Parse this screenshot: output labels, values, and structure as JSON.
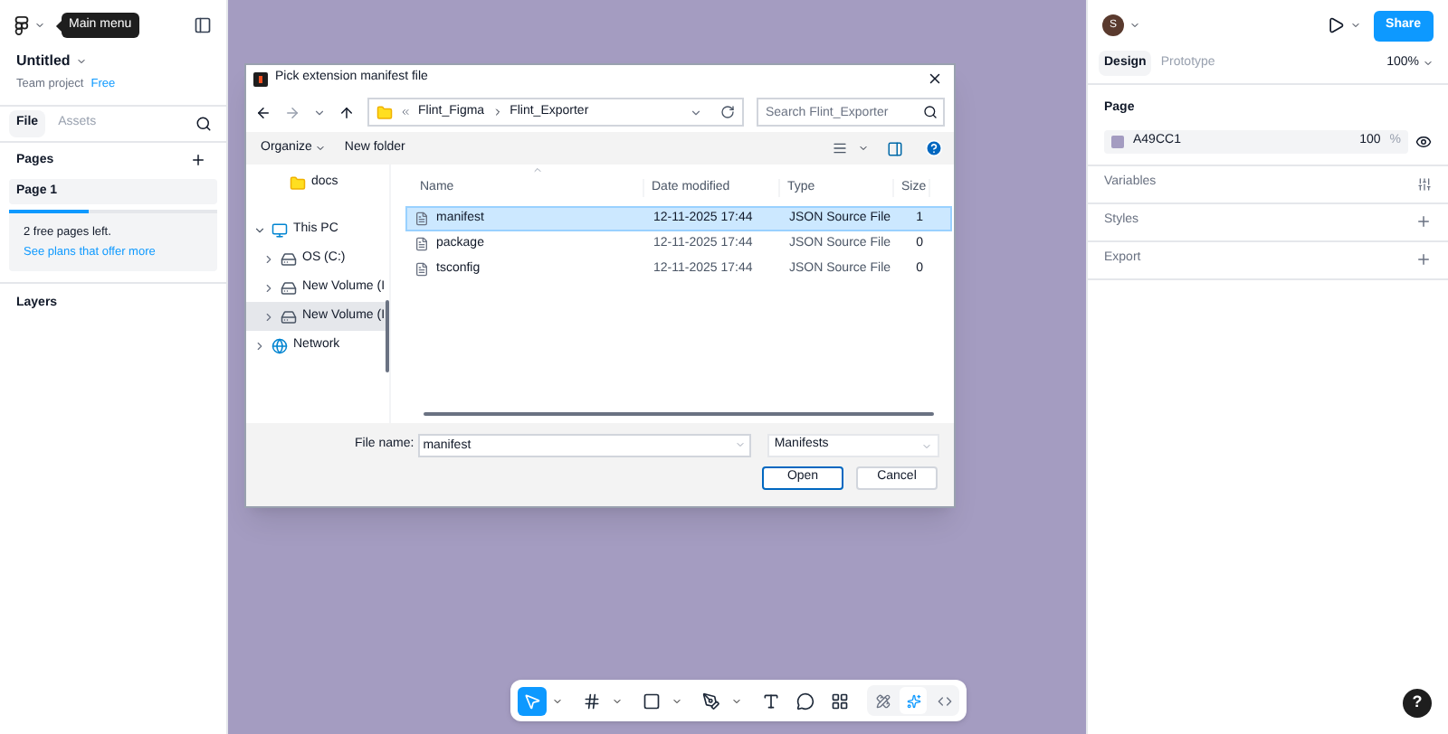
{
  "left_panel": {
    "tooltip": "Main menu",
    "file_name": "Untitled",
    "team": "Team project",
    "plan": "Free",
    "tabs": [
      {
        "label": "File",
        "selected": true
      },
      {
        "label": "Assets",
        "selected": false
      }
    ],
    "pages_title": "Pages",
    "pages": [
      {
        "label": "Page 1",
        "selected": true
      }
    ],
    "upgrade": {
      "level": 0.38,
      "text": "2 free pages left.",
      "link": "See plans that offer more"
    },
    "layers_title": "Layers"
  },
  "dialog": {
    "title": "Pick extension manifest file",
    "path": [
      "Flint_Figma",
      "Flint_Exporter"
    ],
    "search_placeholder": "Search Flint_Exporter",
    "toolbar": [
      "Organize",
      "New folder"
    ],
    "nav": [
      {
        "label": "docs",
        "kind": "folder",
        "selected": false
      },
      {
        "label": "This PC",
        "kind": "pc",
        "expanded": true,
        "selected": false,
        "children": [
          {
            "label": "OS (C:)",
            "kind": "drive",
            "expanded": false,
            "selected": false
          },
          {
            "label": "New Volume (I",
            "kind": "drive",
            "expanded": false,
            "selected": false
          },
          {
            "label": "New Volume (I",
            "kind": "drive",
            "expanded": false,
            "selected": true
          }
        ]
      },
      {
        "label": "Network",
        "kind": "network",
        "expanded": false,
        "selected": false
      }
    ],
    "columns": [
      "Name",
      "Date modified",
      "Type",
      "Size"
    ],
    "rows": [
      {
        "name": "manifest",
        "date": "12-11-2025 17:44",
        "type": "JSON Source File",
        "size": "1",
        "selected": true
      },
      {
        "name": "package",
        "date": "12-11-2025 17:44",
        "type": "JSON Source File",
        "size": "0",
        "selected": false
      },
      {
        "name": "tsconfig",
        "date": "12-11-2025 17:44",
        "type": "JSON Source File",
        "size": "0",
        "selected": false
      }
    ],
    "file_name_label": "File name:",
    "file_name_value": "manifest",
    "filter": "Manifests",
    "buttons": [
      {
        "label": "Open",
        "default": true
      },
      {
        "label": "Cancel",
        "default": false
      }
    ]
  },
  "canvas": {
    "color": "#a49cc1"
  },
  "toolbar": {
    "tools": [
      {
        "kind": "move",
        "selected": true,
        "menu": true
      },
      {
        "kind": "frame",
        "selected": false,
        "menu": true
      },
      {
        "kind": "rect",
        "selected": false,
        "menu": true
      },
      {
        "kind": "pen",
        "selected": false,
        "menu": true
      },
      {
        "kind": "text",
        "selected": false,
        "menu": false
      },
      {
        "kind": "comment",
        "selected": false,
        "menu": false
      },
      {
        "kind": "actions",
        "selected": false,
        "menu": false
      }
    ],
    "modes": [
      {
        "kind": "draw",
        "selected": false
      },
      {
        "kind": "design",
        "selected": true
      },
      {
        "kind": "dev",
        "selected": false
      }
    ]
  },
  "right_panel": {
    "avatar": "S",
    "share": "Share",
    "tabs": [
      {
        "label": "Design",
        "selected": true
      },
      {
        "label": "Prototype",
        "selected": false
      }
    ],
    "zoom": "100%",
    "page_title": "Page",
    "page_fill": {
      "color": "#a49cc1",
      "hex": "A49CC1",
      "opacity": "100",
      "unit": "%"
    },
    "sections": [
      {
        "label": "Variables",
        "kind": "variables"
      },
      {
        "label": "Styles",
        "kind": "add"
      },
      {
        "label": "Export",
        "kind": "add"
      }
    ]
  },
  "help": "?"
}
